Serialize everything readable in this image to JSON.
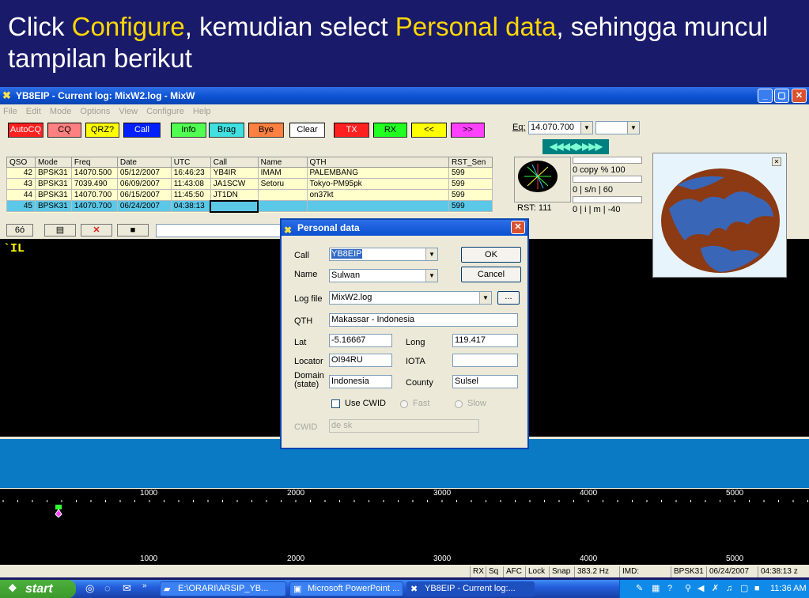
{
  "slide": {
    "title_part1": "Click ",
    "title_hl1": "Configure",
    "title_part2": ", kemudian select ",
    "title_hl2": "Personal data",
    "title_part3": ", sehingga muncul tampilan berikut"
  },
  "window": {
    "title": "YB8EIP - Current log: MixW2.log - MixW",
    "min": "_",
    "max": "▢",
    "close": "✕"
  },
  "menu": [
    "File",
    "Edit",
    "Mode",
    "Options",
    "View",
    "Configure",
    "Help"
  ],
  "toolbar": [
    {
      "label": "AutoCQ",
      "color": "#ff2020",
      "fg": "#ffffff"
    },
    {
      "label": "CQ",
      "color": "#ff8080",
      "fg": "#000000"
    },
    {
      "label": "QRZ?",
      "color": "#ffff00",
      "fg": "#000000"
    },
    {
      "label": "Call",
      "color": "#0020ff",
      "fg": "#ffffff"
    },
    {
      "label": "Info",
      "color": "#50ff50",
      "fg": "#000000"
    },
    {
      "label": "Brag",
      "color": "#40e0e0",
      "fg": "#000000"
    },
    {
      "label": "Bye",
      "color": "#ff8040",
      "fg": "#000000"
    },
    {
      "label": "Clear",
      "color": "#ffffff",
      "fg": "#000000"
    },
    {
      "label": "TX",
      "color": "#ff2020",
      "fg": "#ffffff"
    },
    {
      "label": "RX",
      "color": "#20ff20",
      "fg": "#000000"
    },
    {
      "label": "<<",
      "color": "#ffff00",
      "fg": "#000000"
    },
    {
      "label": ">>",
      "color": "#ff40ff",
      "fg": "#000000"
    }
  ],
  "eq": {
    "label": "Eq:",
    "value": "14.070.700",
    "arrows": "◀◀◀◀▶▶▶▶"
  },
  "qso_table": {
    "headers": [
      "QSO",
      "Mode",
      "Freq",
      "Date",
      "UTC",
      "Call",
      "Name",
      "QTH",
      "RST_Sen"
    ],
    "rows": [
      [
        "42",
        "BPSK31",
        "14070.500",
        "05/12/2007",
        "16:46:23",
        "YB4IR",
        "IMAM",
        "PALEMBANG",
        "599"
      ],
      [
        "43",
        "BPSK31",
        "7039.490",
        "06/09/2007",
        "11:43:08",
        "JA1SCW",
        "Setoru",
        "Tokyo-PM95pk",
        "599"
      ],
      [
        "44",
        "BPSK31",
        "14070.700",
        "06/15/2007",
        "11:45:50",
        "JT1DN",
        "",
        "on37kt",
        "599"
      ],
      [
        "45",
        "BPSK31",
        "14070.700",
        "06/24/2007",
        "04:38:13",
        "",
        "",
        "",
        "599"
      ]
    ]
  },
  "meters": {
    "copy_label": "0   copy %     100",
    "sn_label": "0     | s/n |     60",
    "imd_label": "0    | i  | m  |  -40",
    "rst": "RST: 111"
  },
  "rx_text": "`IL",
  "scale_ticks": [
    "1000",
    "2000",
    "3000",
    "4000",
    "5000"
  ],
  "status": {
    "items": [
      "RX",
      "Sq",
      "AFC",
      "Lock",
      "Snap",
      "383.2 Hz",
      "IMD:",
      "BPSK31",
      "06/24/2007",
      "04:38:13 z"
    ]
  },
  "dialog": {
    "title": "Personal data",
    "call_label": "Call",
    "call_value": "YB8EIP",
    "name_label": "Name",
    "name_value": "Sulwan",
    "logfile_label": "Log file",
    "logfile_value": "MixW2.log",
    "browse": "...",
    "qth_label": "QTH",
    "qth_value": "Makassar - Indonesia",
    "lat_label": "Lat",
    "lat_value": "-5.16667",
    "long_label": "Long",
    "long_value": "119.417",
    "locator_label": "Locator",
    "locator_value": "OI94RU",
    "iota_label": "IOTA",
    "iota_value": "",
    "domain_label": "Domain (state)",
    "domain_value": "Indonesia",
    "county_label": "County",
    "county_value": "Sulsel",
    "usecwid_label": "Use CWID",
    "fast_label": "Fast",
    "slow_label": "Slow",
    "cwid_label": "CWID",
    "cwid_value": "de  sk",
    "ok": "OK",
    "cancel": "Cancel"
  },
  "taskbar": {
    "start": "start",
    "items": [
      {
        "label": "E:\\ORARI\\ARSIP_YB...",
        "icon": "folder-icon"
      },
      {
        "label": "Microsoft PowerPoint ...",
        "icon": "powerpoint-icon"
      },
      {
        "label": "YB8EIP - Current log:...",
        "icon": "mixw-icon"
      }
    ],
    "time": "11:36 AM"
  }
}
